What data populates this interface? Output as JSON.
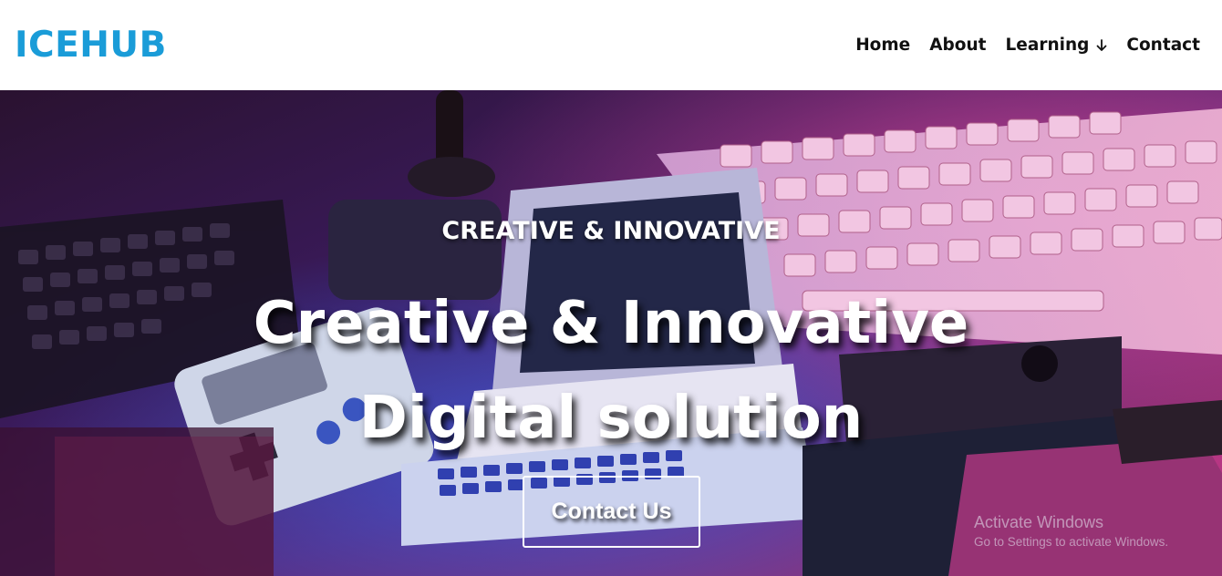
{
  "brand": {
    "logo_text": "ICEHUB",
    "color": "#1a9cd8"
  },
  "nav": {
    "items": [
      {
        "label": "Home"
      },
      {
        "label": "About"
      },
      {
        "label": "Learning",
        "icon": "arrow-down-icon"
      },
      {
        "label": "Contact"
      }
    ]
  },
  "hero": {
    "eyebrow": "CREATIVE & INNOVATIVE",
    "headline_line1": "Creative & Innovative",
    "headline_line2": "Digital solution",
    "cta_label": "Contact Us",
    "background": "retro computer and game console photo with pink and blue lighting"
  },
  "watermark": {
    "title": "Activate Windows",
    "subtitle": "Go to Settings to activate Windows."
  }
}
